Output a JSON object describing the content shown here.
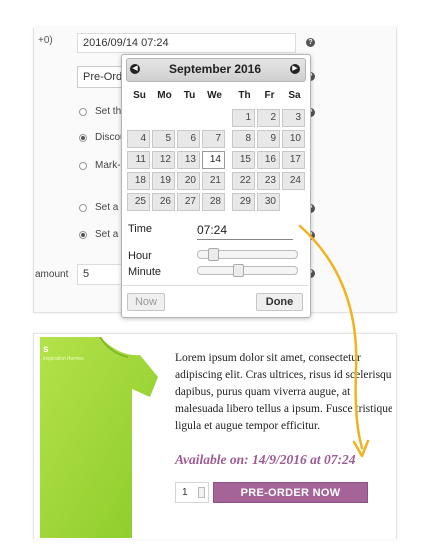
{
  "admin": {
    "timezone_suffix": "+0)",
    "datetime_value": "2016/09/14 07:24",
    "preorder_select": "Pre-Ord",
    "options": [
      {
        "label": "Set the",
        "checked": false
      },
      {
        "label": "Discou",
        "checked": true
      },
      {
        "label": "Mark-u",
        "checked": false
      },
      {
        "label": "Set a f",
        "checked": false
      },
      {
        "label": "Set a p",
        "checked": true
      }
    ],
    "amount_label": "amount",
    "amount_value": "5",
    "help_icon": "?"
  },
  "datepicker": {
    "month_title": "September 2016",
    "prev_icon": "◀",
    "next_icon": "▶",
    "weekdays": [
      "Su",
      "Mo",
      "Tu",
      "We",
      "Th",
      "Fr",
      "Sa"
    ],
    "weeks": [
      [
        "",
        "",
        "",
        "",
        "1",
        "2",
        "3"
      ],
      [
        "4",
        "5",
        "6",
        "7",
        "8",
        "9",
        "10"
      ],
      [
        "11",
        "12",
        "13",
        "14",
        "15",
        "16",
        "17"
      ],
      [
        "18",
        "19",
        "20",
        "21",
        "22",
        "23",
        "24"
      ],
      [
        "25",
        "26",
        "27",
        "28",
        "29",
        "30",
        ""
      ]
    ],
    "today": "14",
    "time_label": "Time",
    "time_value": "07:24",
    "hour_label": "Hour",
    "minute_label": "Minute",
    "now_button": "Now",
    "done_button": "Done"
  },
  "product": {
    "description_lines": [
      "Lorem ipsum dolor sit amet, consectetur",
      "adipiscing elit. Cras ultrices, risus id scelerisque",
      "dapibus, purus quam viverra augue, at",
      "malesuada libero tellus a ipsum. Fusce tristique",
      "ligula et augue tempor efficitur."
    ],
    "availability": "Available on: 14/9/2016 at 07:24",
    "quantity": "1",
    "preorder_button": "PRE-ORDER NOW",
    "image_caption": "s",
    "image_subcaption": "inspiration themes"
  },
  "colors": {
    "accent": "#a46497",
    "availability": "#9b5b93",
    "shirt": "#a5d93a",
    "arrow": "#f2b21d"
  }
}
